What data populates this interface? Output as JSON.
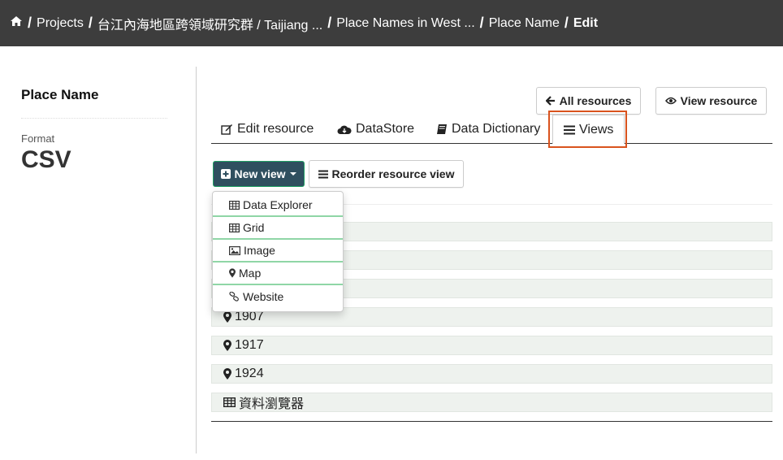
{
  "breadcrumb": {
    "items": [
      "Projects",
      "台江內海地區跨領域研究群 / Taijiang ...",
      "Place Names in West ...",
      "Place Name"
    ],
    "current": "Edit",
    "separator": "/"
  },
  "sidebar": {
    "title": "Place Name",
    "format_label": "Format",
    "format_value": "CSV"
  },
  "buttons": {
    "all_resources": "All resources",
    "view_resource": "View resource",
    "new_view": "New view",
    "reorder": "Reorder resource view"
  },
  "tabs": [
    {
      "label": "Edit resource",
      "icon": "edit-icon"
    },
    {
      "label": "DataStore",
      "icon": "cloud-icon"
    },
    {
      "label": "Data Dictionary",
      "icon": "book-icon"
    },
    {
      "label": "Views",
      "icon": "list-icon",
      "active": true
    }
  ],
  "dropdown": {
    "items": [
      {
        "label": "Data Explorer",
        "icon": "table-icon"
      },
      {
        "label": "Grid",
        "icon": "table-icon"
      },
      {
        "label": "Image",
        "icon": "image-icon"
      },
      {
        "label": "Map",
        "icon": "map-marker-icon"
      },
      {
        "label": "Website",
        "icon": "link-icon"
      }
    ]
  },
  "views": [
    {
      "label": "1907",
      "icon": "map-marker-icon"
    },
    {
      "label": "1917",
      "icon": "map-marker-icon"
    },
    {
      "label": "1924",
      "icon": "map-marker-icon"
    },
    {
      "label": "資料瀏覽器",
      "icon": "table-icon"
    }
  ],
  "colors": {
    "header_bg": "#3d3d3d",
    "new_view_bg": "#2f4f5f",
    "highlight": "#d9531e",
    "dropdown_divider": "#8fd6a6",
    "row_bg": "#eef2ee"
  }
}
